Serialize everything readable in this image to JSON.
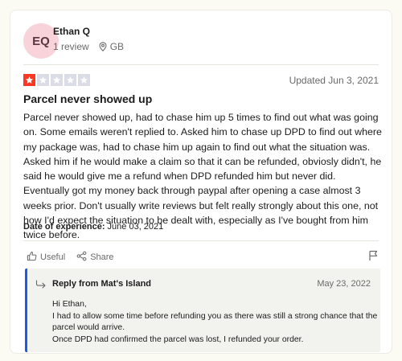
{
  "reviewer": {
    "initials": "EQ",
    "name": "Ethan Q",
    "review_count": "1 review",
    "country": "GB",
    "avatar_color": "#f9d3da"
  },
  "review": {
    "rating": 1,
    "max_rating": 5,
    "star_fill_color": "#ff3722",
    "star_empty_color": "#dcdce6",
    "updated": "Updated Jun 3, 2021",
    "title": "Parcel never showed up",
    "body": "Parcel never showed up, had to chase him up 5 times to find out what was going on. Some emails weren't replied to. Asked him to chase up DPD to find out where my package was, had to chase him up again to find out what the situation was. Asked him if he would make a claim so that it can be refunded, obviosly didn't, he said he would give me a refund when DPD refunded him but never did. Eventually got my money back through paypal after opening a case almost 3 weeks prior. Don't usually write reviews but felt really strongly about this one, not how I'd expect the situation to be dealt with, especially as I've bought from him twice before.",
    "date_label": "Date of experience:",
    "date_value": "June 03, 2021"
  },
  "actions": {
    "useful_label": "Useful",
    "share_label": "Share",
    "flag_icon": "flag-icon"
  },
  "reply": {
    "title": "Reply from Mat's Island",
    "date": "May 23, 2022",
    "accent_color": "#1a5ce8",
    "lines": [
      "Hi Ethan,",
      "I had to allow some time before refunding you as there was still a strong chance that the",
      "parcel would arrive.",
      "Once DPD had confirmed the parcel was lost, I refunded your order."
    ]
  }
}
